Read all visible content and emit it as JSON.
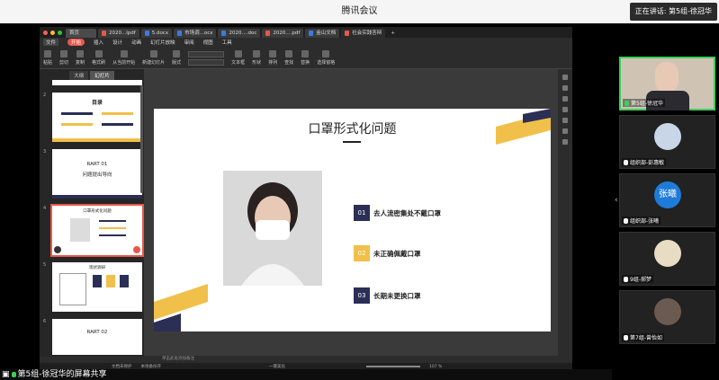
{
  "window": {
    "title": "腾讯会议",
    "speaking": "正在讲话: 第5组-徐冠华"
  },
  "tabs": [
    {
      "label": "首页",
      "color": "#555"
    },
    {
      "label": "2020...lpdf",
      "color": "#e8584a"
    },
    {
      "label": "5.docx",
      "color": "#3a7be0"
    },
    {
      "label": "市场调...ocx",
      "color": "#3a7be0"
    },
    {
      "label": "2020....doc",
      "color": "#3a7be0"
    },
    {
      "label": "2020....pdf",
      "color": "#e8584a"
    },
    {
      "label": "金山文档",
      "color": "#3a7be0"
    },
    {
      "label": "社会实践答辩",
      "color": "#e8584a"
    }
  ],
  "menu": {
    "file": "文件",
    "items": [
      "开始",
      "插入",
      "设计",
      "动画",
      "幻灯片放映",
      "审阅",
      "视图",
      "工具"
    ]
  },
  "ribbon": [
    "粘贴",
    "剪切",
    "复制",
    "格式刷",
    "从当前开始",
    "新建幻灯片",
    "版式",
    "文本框",
    "形状",
    "排列",
    "查找",
    "替换",
    "选择窗格"
  ],
  "panel_tabs": [
    "大纲",
    "幻灯片"
  ],
  "thumbnails": [
    {
      "num": "2",
      "title": "目录"
    },
    {
      "num": "3",
      "title": "RART 01",
      "sub": "问题提出导向"
    },
    {
      "num": "4",
      "title": "口罩形式化问题"
    },
    {
      "num": "5",
      "title": "现状调研"
    },
    {
      "num": "6",
      "title": "RART 02"
    }
  ],
  "slide": {
    "title": "口罩形式化问题",
    "items": [
      {
        "num": "01",
        "text": "去人流密集处不戴口罩",
        "color": "#2b2f55"
      },
      {
        "num": "02",
        "text": "未正确佩戴口罩",
        "color": "#f0c04a"
      },
      {
        "num": "03",
        "text": "长期未更换口罩",
        "color": "#2b2f55"
      }
    ],
    "accent_yellow": "#f0c04a",
    "accent_navy": "#2b2f55"
  },
  "note": "单击此处添加备注",
  "status": {
    "protect": "文档未保护",
    "recover": "本地备份开",
    "beautify": "一键美化",
    "zoom": "107 %"
  },
  "share_label": "第5组-徐冠华的屏幕共享",
  "participants": [
    {
      "name": "第5组-徐冠华",
      "speaking": true,
      "mic": "on"
    },
    {
      "name": "组织部-彭惠敏",
      "speaking": false,
      "mic": "off"
    },
    {
      "name": "组织部-张曦",
      "speaking": false,
      "mic": "off",
      "initials": "张曦"
    },
    {
      "name": "9组-郝梦",
      "speaking": false,
      "mic": "off"
    },
    {
      "name": "第7组-曾怡如",
      "speaking": false,
      "mic": "off"
    }
  ]
}
